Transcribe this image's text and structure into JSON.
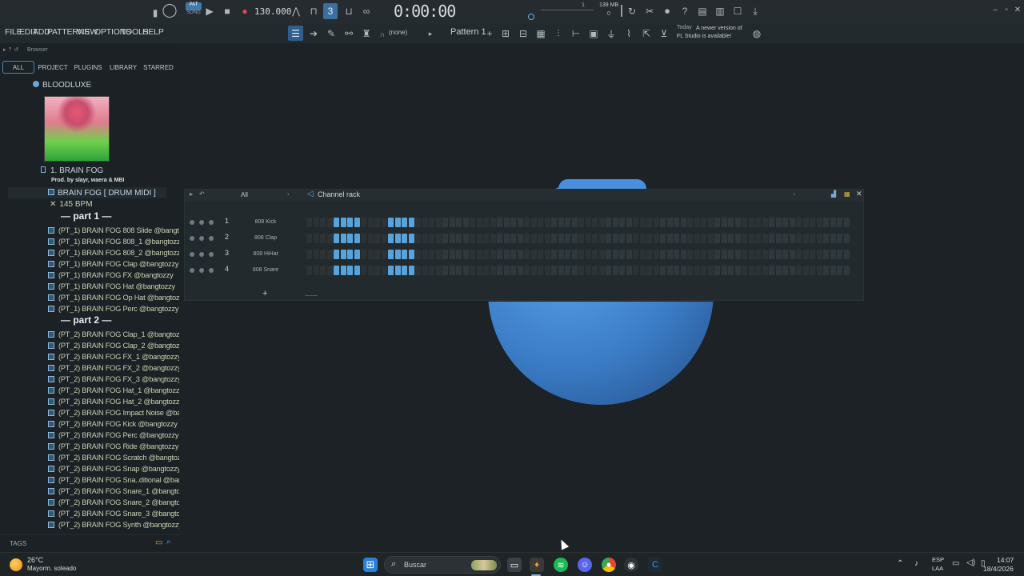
{
  "toolbar": {
    "tempo": "130.000",
    "time": "0:00:00",
    "pat_label": "PAT",
    "song_label": "SONG",
    "mem": "139 MB",
    "mem_sub": "0",
    "cpu": "1",
    "hint_label": "Today",
    "hint": "A newer version of FL Studio is available!"
  },
  "menu": [
    "FILE",
    "EDIT",
    "ADD",
    "PATTERNS",
    "VIEW",
    "OPTIONS",
    "TOOLS",
    "HELP"
  ],
  "pattern_bar": {
    "snap": "(none)",
    "pattern": "Pattern 1"
  },
  "browser": {
    "title": "Browser",
    "tabs": [
      "ALL",
      "PROJECT",
      "PLUGINS",
      "LIBRARY",
      "STARRED"
    ],
    "root_folder": "BLOODLUXE",
    "sub_folder": "1. BRAIN FOG",
    "credits": "Prod. by slayr, waera & MBI",
    "pack_folder": "BRAIN FOG [ DRUM MIDI ]",
    "bpm": "145 BPM",
    "part1_header": "— part 1 —",
    "part1_items": [
      "(PT_1) BRAIN FOG 808 Slide @bangtozzy",
      "(PT_1) BRAIN FOG 808_1 @bangtozzy",
      "(PT_1) BRAIN FOG 808_2 @bangtozzy",
      "(PT_1) BRAIN FOG Clap @bangtozzy",
      "(PT_1) BRAIN FOG FX @bangtozzy",
      "(PT_1) BRAIN FOG Hat @bangtozzy",
      "(PT_1) BRAIN FOG Op Hat @bangtozzy",
      "(PT_1) BRAIN FOG Perc @bangtozzy"
    ],
    "part2_header": "— part 2 —",
    "part2_items": [
      "(PT_2) BRAIN FOG Clap_1 @bangtozzy",
      "(PT_2) BRAIN FOG Clap_2 @bangtozzy",
      "(PT_2) BRAIN FOG FX_1 @bangtozzy",
      "(PT_2) BRAIN FOG FX_2 @bangtozzy",
      "(PT_2) BRAIN FOG FX_3 @bangtozzy",
      "(PT_2) BRAIN FOG Hat_1 @bangtozzy",
      "(PT_2) BRAIN FOG Hat_2 @bangtozzy",
      "(PT_2) BRAIN FOG Impact Noise @bangtozzy",
      "(PT_2) BRAIN FOG Kick @bangtozzy",
      "(PT_2) BRAIN FOG Perc @bangtozzy",
      "(PT_2) BRAIN FOG Ride @bangtozzy",
      "(PT_2) BRAIN FOG Scratch @bangtozzy",
      "(PT_2) BRAIN FOG Snap @bangtozzy",
      "(PT_2) BRAIN FOG Sna..ditional @bangtozzy",
      "(PT_2) BRAIN FOG Snare_1 @bangtozzy",
      "(PT_2) BRAIN FOG Snare_2 @bangtozzy",
      "(PT_2) BRAIN FOG Snare_3 @bangtozzy",
      "(PT_2) BRAIN FOG Synth @bangtozzy"
    ],
    "tags_label": "TAGS"
  },
  "channel_rack": {
    "title": "Channel rack",
    "filter": "All",
    "channels": [
      {
        "num": "1",
        "name": "808 Kick"
      },
      {
        "num": "2",
        "name": "808 Clap"
      },
      {
        "num": "3",
        "name": "808 HiHat"
      },
      {
        "num": "4",
        "name": "808 Snare"
      }
    ],
    "add_label": "+"
  },
  "taskbar": {
    "temp": "26°C",
    "weather": "Mayorm. soleado",
    "search": "Buscar",
    "lang": "ESP",
    "lang_sub": "LAA",
    "clock": "14:07",
    "date": "18/4/2026"
  },
  "colors": {
    "accent": "#57a3dc",
    "bg": "#1c2226",
    "panel": "#222a2e"
  }
}
